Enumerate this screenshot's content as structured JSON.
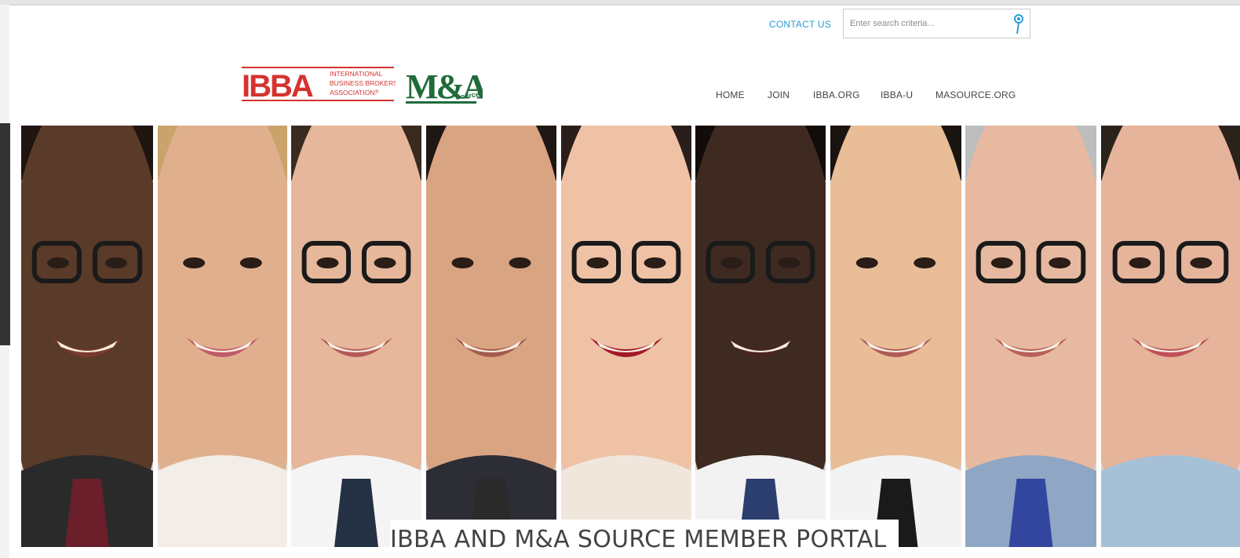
{
  "header": {
    "contact_label": "CONTACT US",
    "search": {
      "placeholder": "Enter search criteria..."
    },
    "logos": {
      "ibba": {
        "mark": "IBBA",
        "line1": "INTERNATIONAL",
        "line2": "BUSINESS BROKERS",
        "line3": "ASSOCIATION.",
        "reg": "®"
      },
      "masource": {
        "mark": "M&A",
        "sub": "Source"
      }
    },
    "nav": [
      {
        "label": "HOME"
      },
      {
        "label": "JOIN"
      },
      {
        "label": "IBBA.ORG"
      },
      {
        "label": "IBBA-U"
      },
      {
        "label": "MASOURCE.ORG"
      }
    ]
  },
  "hero": {
    "title": "IBBA AND M&A SOURCE MEMBER PORTAL",
    "panel_count": 9
  },
  "colors": {
    "accent_link": "#2a9bd7",
    "ibba_red": "#d4332f",
    "masource_green": "#1f6b3a"
  }
}
